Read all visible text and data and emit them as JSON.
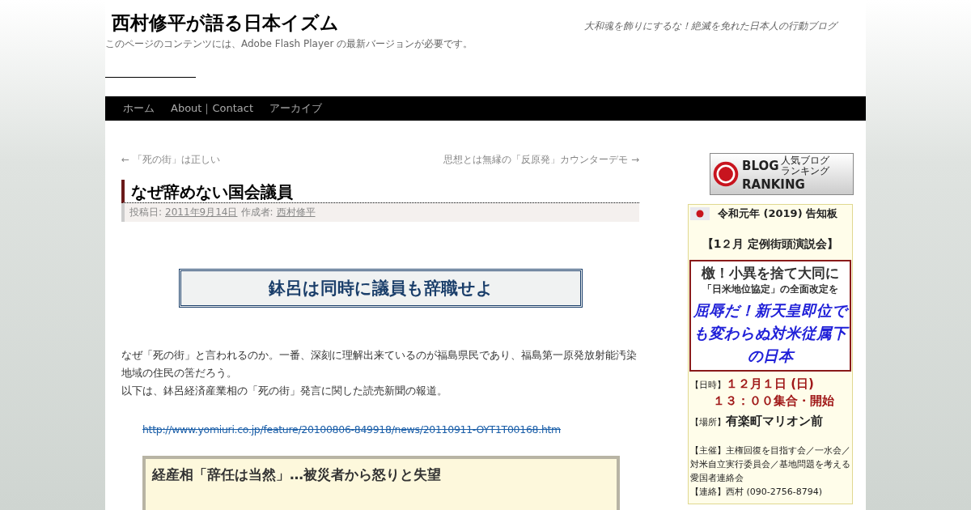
{
  "site": {
    "title": "西村修平が語る日本イズム",
    "tagline": "大和魂を飾りにするな！絶滅を免れた日本人の行動ブログ",
    "flash_notice": "このページのコンテンツには、Adobe Flash Player の最新バージョンが必要です。"
  },
  "nav": [
    {
      "label": "ホーム"
    },
    {
      "label": "About｜Contact"
    },
    {
      "label": "アーカイブ"
    }
  ],
  "post_nav": {
    "previous": "← 「死の街」は正しい",
    "next": "思想とは無縁の「反原発」カウンターデモ →"
  },
  "post": {
    "title": "なぜ辞めない国会議員",
    "meta_posted": "投稿日:",
    "date": "2011年9月14日",
    "meta_author": "作成者:",
    "author": "西村修平",
    "headline": "鉢呂は同時に議員も辞職せよ",
    "paragraphs": [
      "なぜ「死の街」と言われるのか。一番、深刻に理解出来ているのが福島県民であり、福島第一原発放射能汚染地域の住民の筈だろう。",
      "以下は、鉢呂経済産業相の「死の街」発言に関した読売新聞の報道。"
    ],
    "link": {
      "text": "http://www.yomiuri.co.jp/feature/20100806-849918/news/20110911-OYT1T00168.htm",
      "strikethrough": true
    },
    "quote_title": "経産相「辞任は当然」…被災者から怒りと失望"
  },
  "sidebar": {
    "banner": {
      "big": "BLOG",
      "big2": "RANKING",
      "small": "人気ブログランキング"
    },
    "notice": {
      "title": "令和元年 (2019) 告知板",
      "event": "【1２月 定例街頭演説会】",
      "poster": {
        "line1": "檄！小異を捨て大同に",
        "line2": "「日米地位協定」の全面改定を",
        "slogan": "屈辱だ！新天皇即位でも変わらぬ対米従属下の日本"
      },
      "date_label": "【日時】",
      "date": "１２月１日 (日)",
      "time": "１３：００集合・開始",
      "place_label": "【場所】",
      "place": "有楽町マリオン前",
      "organizer": "【主催】主権回復を目指す会／一水会／対米自立実行委員会／基地問題を考える愛国者連絡会",
      "contact": "【連絡】西村 (090-2756-8794)"
    }
  }
}
